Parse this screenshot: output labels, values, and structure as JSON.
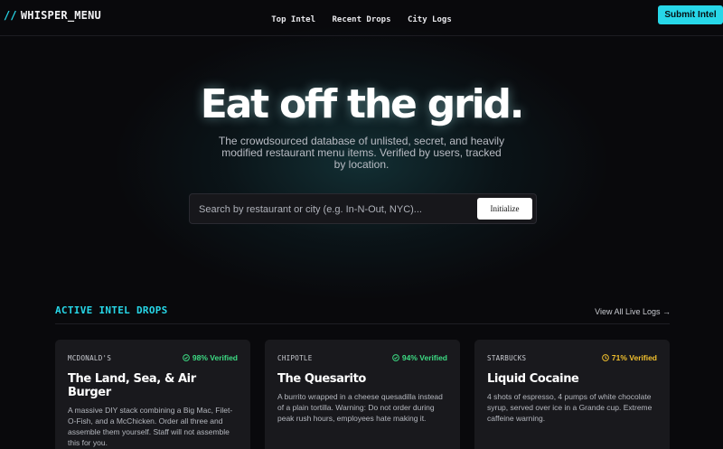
{
  "header": {
    "logo_slashes": "//",
    "logo_text": "WHISPER_MENU",
    "nav": [
      "Top Intel",
      "Recent Drops",
      "City Logs"
    ],
    "submit_label": "Submit Intel"
  },
  "hero": {
    "title": "Eat off the grid.",
    "subtitle": "The crowdsourced database of unlisted, secret, and heavily modified restaurant menu items. Verified by users, tracked by location."
  },
  "search": {
    "placeholder": "Search by restaurant or city (e.g. In-N-Out, NYC)...",
    "value": "",
    "button_label": "Initialize"
  },
  "section": {
    "title": "ACTIVE INTEL DROPS",
    "view_all": "View All Live Logs →"
  },
  "colors": {
    "accent": "#27d7e8",
    "verified_green": "#3ddc84",
    "verified_amber": "#f2c12e"
  },
  "cards": [
    {
      "brand": "MCDONALD'S",
      "verified": "98% Verified",
      "status": "green",
      "icon": "check-circle-icon",
      "title": "The Land, Sea, & Air Burger",
      "desc": "A massive DIY stack combining a Big Mac, Filet-O-Fish, and a McChicken. Order all three and assemble them yourself. Staff will not assemble this for you."
    },
    {
      "brand": "CHIPOTLE",
      "verified": "94% Verified",
      "status": "green",
      "icon": "check-circle-icon",
      "title": "The Quesarito",
      "desc": "A burrito wrapped in a cheese quesadilla instead of a plain tortilla. Warning: Do not order during peak rush hours, employees hate making it."
    },
    {
      "brand": "STARBUCKS",
      "verified": "71% Verified",
      "status": "amber",
      "icon": "clock-icon",
      "title": "Liquid Cocaine",
      "desc": "4 shots of espresso, 4 pumps of white chocolate syrup, served over ice in a Grande cup. Extreme caffeine warning."
    }
  ]
}
